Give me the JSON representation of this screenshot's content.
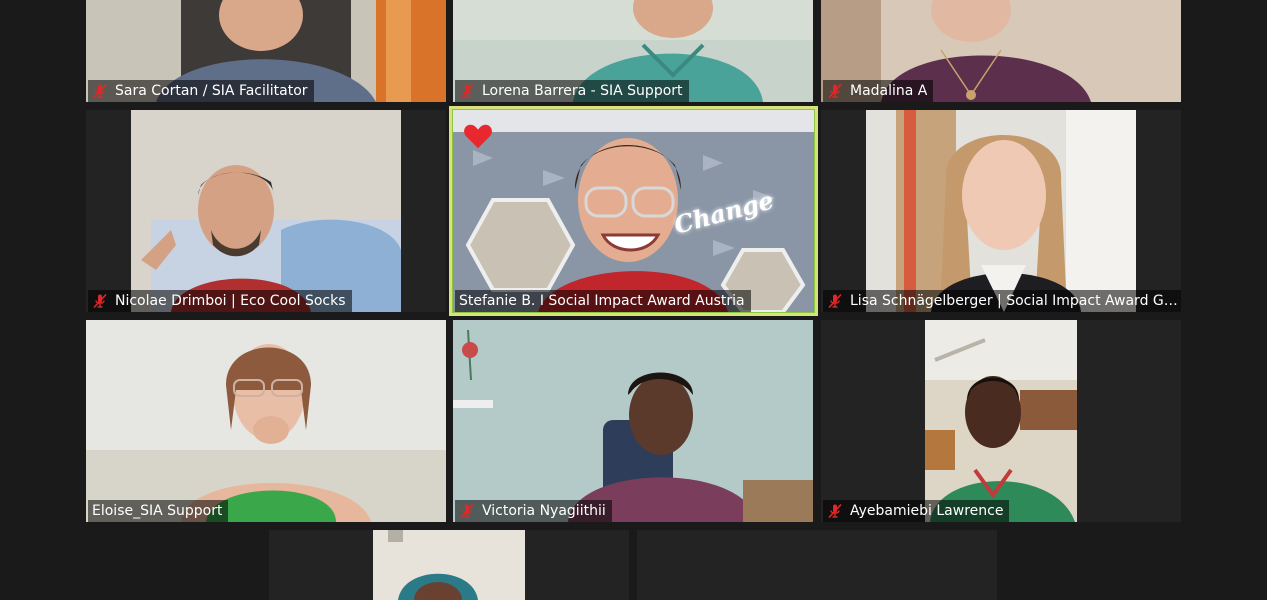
{
  "participants": [
    {
      "name": "Sara Cortan / SIA Facilitator",
      "muted": true
    },
    {
      "name": "Lorena Barrera - SIA Support",
      "muted": true
    },
    {
      "name": "Madalina A",
      "muted": true
    },
    {
      "name": "Nicolae Drimboi | Eco Cool Socks",
      "muted": true
    },
    {
      "name": "Stefanie B. I Social Impact Award Austria",
      "muted": false,
      "active_speaker": true,
      "reaction": "heart-icon",
      "background_text": "Change"
    },
    {
      "name": "Lisa Schnägelberger | Social Impact Award Ge...",
      "muted": true
    },
    {
      "name": "Eloise_SIA Support",
      "muted": false
    },
    {
      "name": "Victoria Nyagiithii",
      "muted": true
    },
    {
      "name": "Ayebamiebi Lawrence",
      "muted": true
    },
    {
      "name": "",
      "muted": false
    },
    {
      "name": "",
      "muted": false
    }
  ],
  "colors": {
    "background": "#1a1a1a",
    "tile": "#232323",
    "active_speaker_border": "#d6e37a",
    "muted_icon": "#e02828",
    "reaction": "#e8282e"
  }
}
